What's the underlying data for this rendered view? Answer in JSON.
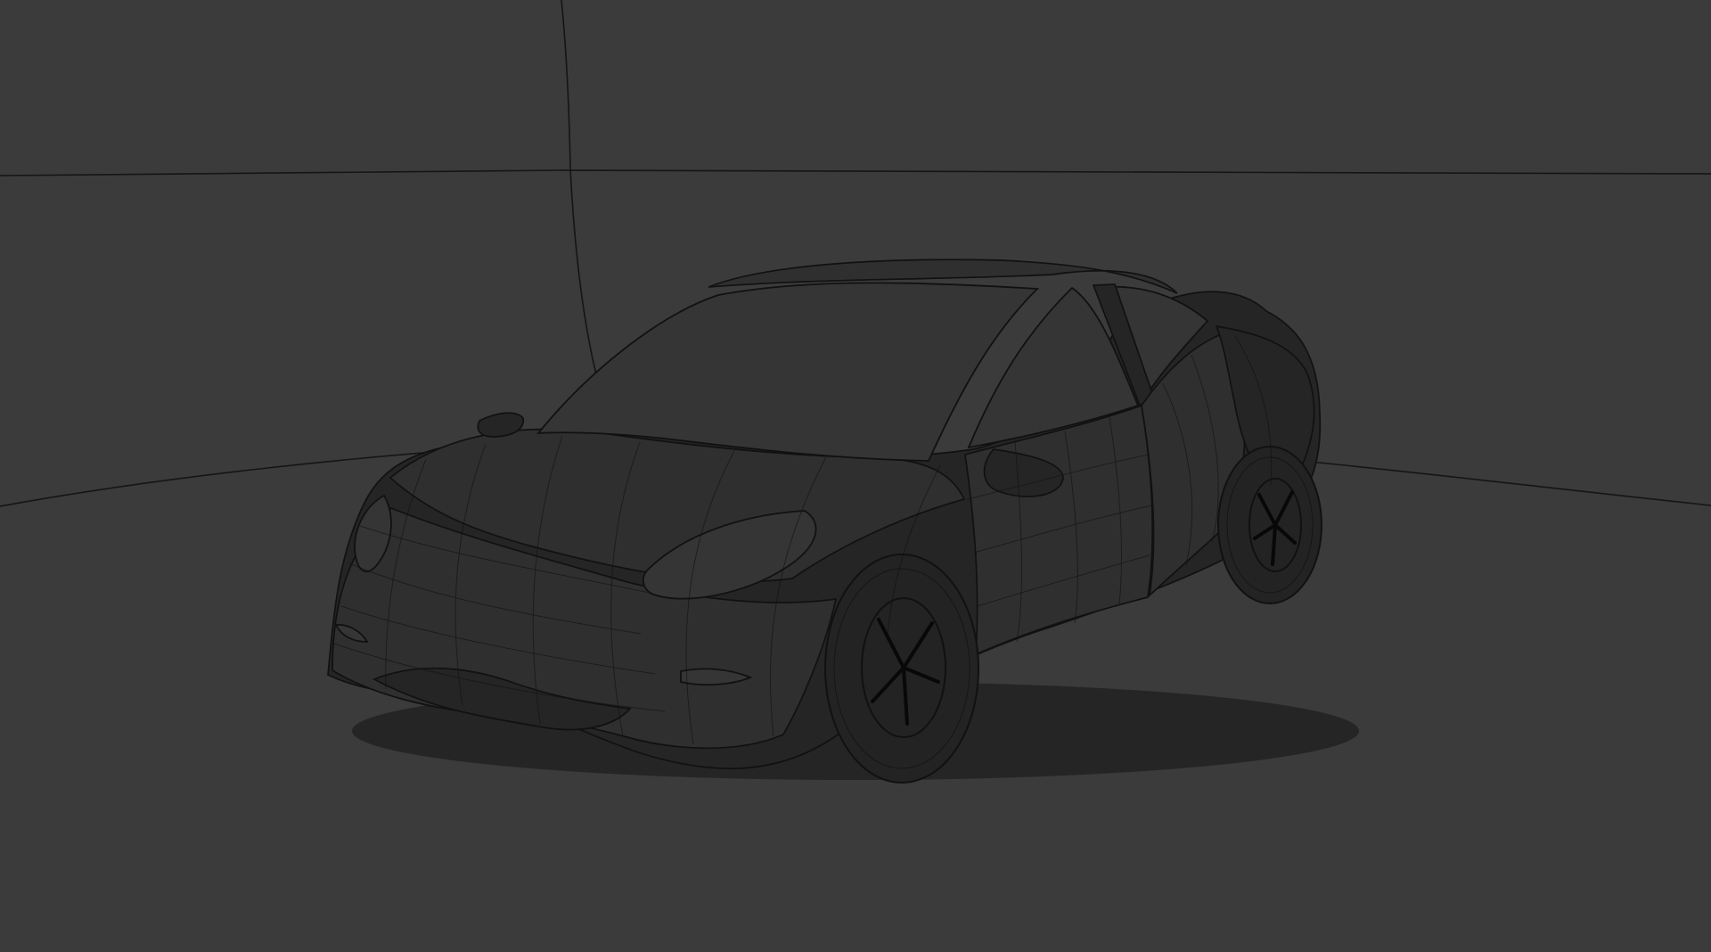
{
  "viewport": {
    "background_color": "#3b3b3b",
    "wireframe_color": "#111111"
  },
  "scene": {
    "object": "wireframe-car",
    "style": "mesh-wireframe"
  }
}
